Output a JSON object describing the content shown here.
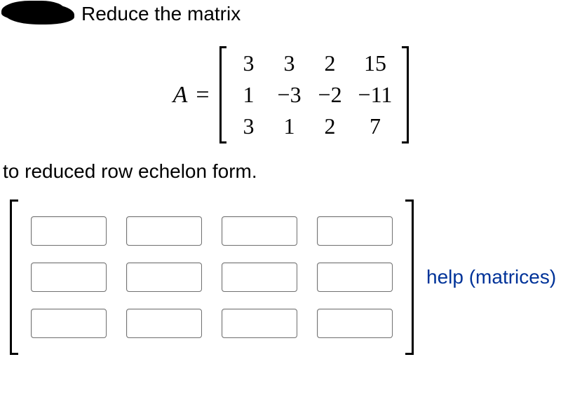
{
  "problem": {
    "intro_text": "Reduce the matrix",
    "to_text": "to reduced row echelon form."
  },
  "matrix": {
    "label": "A",
    "equals": "=",
    "rows": [
      [
        "3",
        "3",
        "2",
        "15"
      ],
      [
        "1",
        "−3",
        "−2",
        "−11"
      ],
      [
        "3",
        "1",
        "2",
        "7"
      ]
    ]
  },
  "answer": {
    "rows": 3,
    "cols": 4,
    "values": [
      [
        "",
        "",
        "",
        ""
      ],
      [
        "",
        "",
        "",
        ""
      ],
      [
        "",
        "",
        "",
        ""
      ]
    ]
  },
  "help": {
    "label": "help (matrices)"
  }
}
